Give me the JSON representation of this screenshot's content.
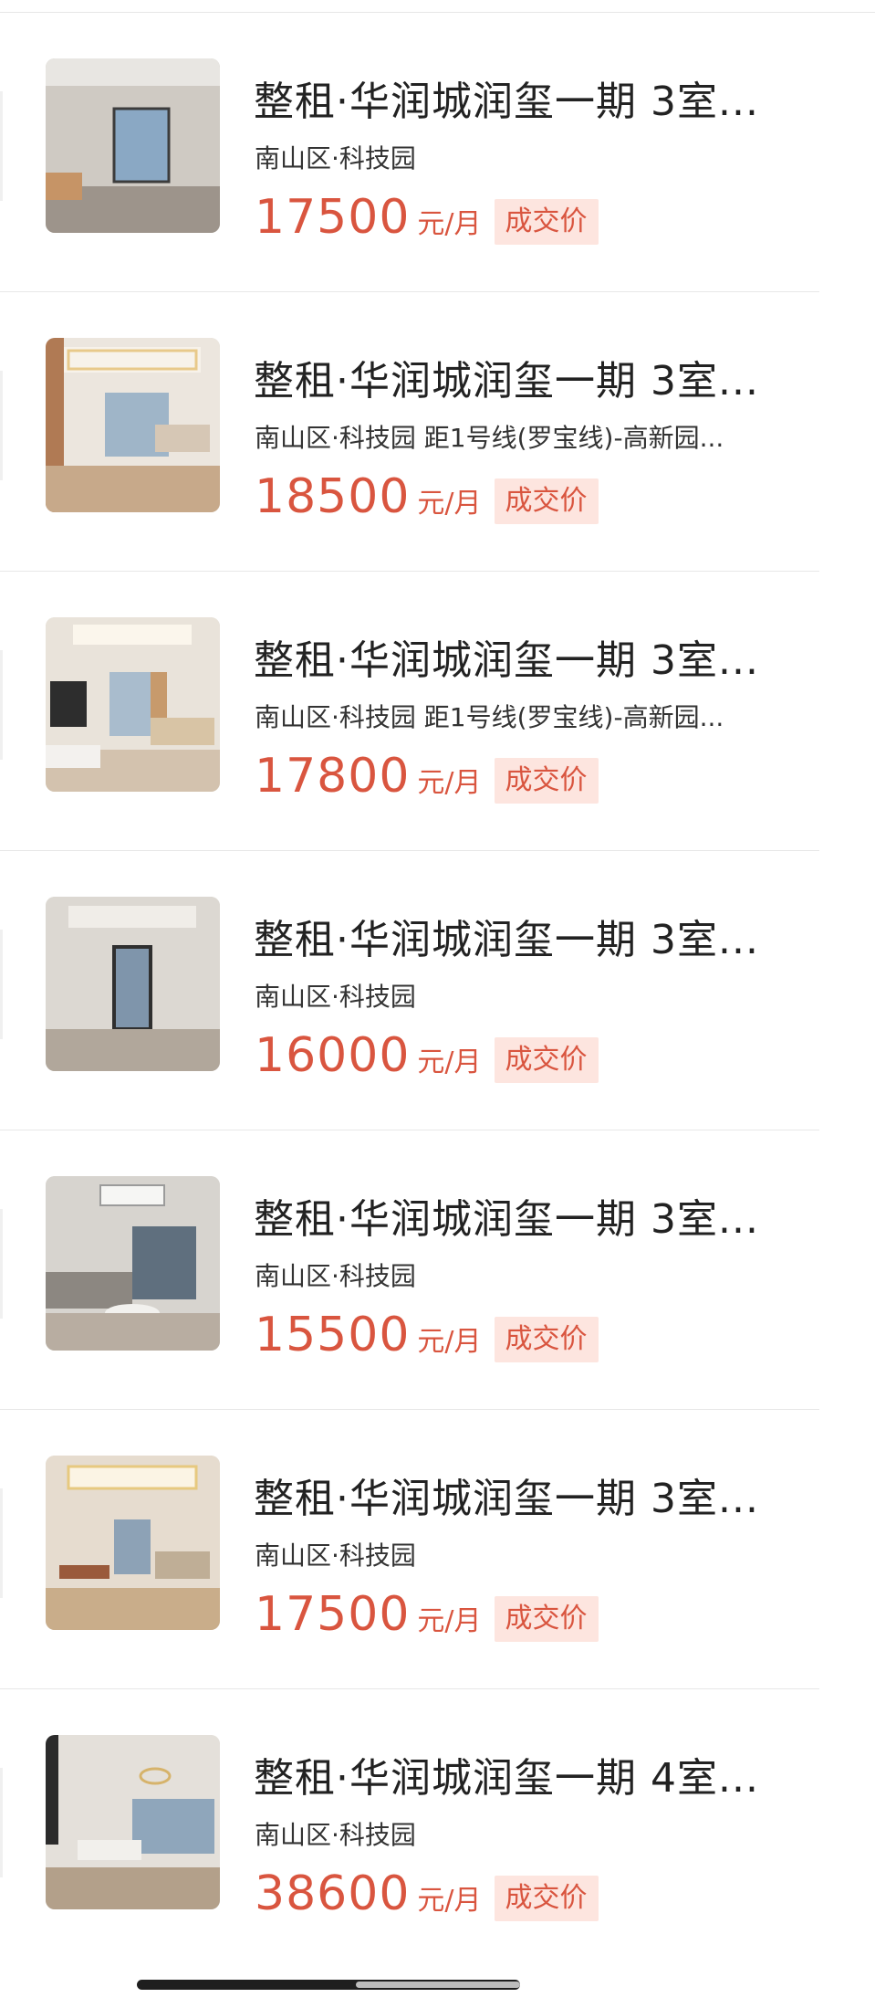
{
  "listings": [
    {
      "title": "整租·华润城润玺一期 3室...",
      "location": "南山区·科技园",
      "price": "17500",
      "unit": "元/月",
      "badge": "成交价"
    },
    {
      "title": "整租·华润城润玺一期 3室...",
      "location": "南山区·科技园 距1号线(罗宝线)-高新园...",
      "price": "18500",
      "unit": "元/月",
      "badge": "成交价"
    },
    {
      "title": "整租·华润城润玺一期 3室...",
      "location": "南山区·科技园 距1号线(罗宝线)-高新园...",
      "price": "17800",
      "unit": "元/月",
      "badge": "成交价"
    },
    {
      "title": "整租·华润城润玺一期 3室...",
      "location": "南山区·科技园",
      "price": "16000",
      "unit": "元/月",
      "badge": "成交价"
    },
    {
      "title": "整租·华润城润玺一期 3室...",
      "location": "南山区·科技园",
      "price": "15500",
      "unit": "元/月",
      "badge": "成交价"
    },
    {
      "title": "整租·华润城润玺一期 3室...",
      "location": "南山区·科技园",
      "price": "17500",
      "unit": "元/月",
      "badge": "成交价"
    },
    {
      "title": "整租·华润城润玺一期 4室...",
      "location": "南山区·科技园",
      "price": "38600",
      "unit": "元/月",
      "badge": "成交价"
    }
  ],
  "colors": {
    "price": "#d9553f",
    "badge_bg": "#fde5df"
  }
}
